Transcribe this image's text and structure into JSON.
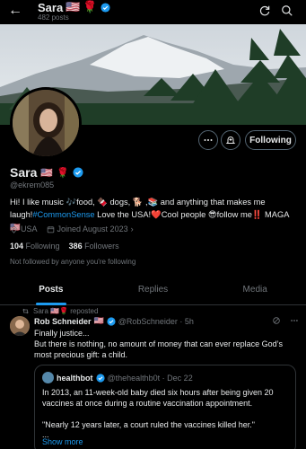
{
  "header": {
    "title": "Sara",
    "post_count": "482 posts"
  },
  "profile": {
    "display_name": "Sara",
    "handle": "@ekrem085",
    "bio": "Hi! I like music 🎶food, 🍫 dogs, 🐕 ,📚 and anything that makes me laugh!#CommonSense Love the USA!❤️Cool people 😎follow me‼️ MAGA🇺🇸",
    "location": "USA",
    "joined": "Joined August 2023",
    "following_count": "104",
    "following_label": "Following",
    "followers_count": "386",
    "followers_label": "Followers",
    "not_followed": "Not followed by anyone you're following",
    "follow_button": "Following"
  },
  "tabs": [
    {
      "label": "Posts",
      "active": true
    },
    {
      "label": "Replies",
      "active": false
    },
    {
      "label": "Media",
      "active": false
    }
  ],
  "tweet": {
    "repost_by": "Sara 🇺🇸🌹 reposted",
    "author": "Rob Schneider",
    "author_handle": "@RobSchneider · 5h",
    "text": "Finally justice...\nBut there is nothing, no amount of money that can ever replace God’s most precious gift: a child.",
    "quote": {
      "author": "healthbot",
      "handle": "@thehealthb0t · Dec 22",
      "text": "In 2013, an 11-week-old baby died six hours after being given 20 vaccines at once during a routine vaccination appointment.\n\n\"Nearly 12 years later, a court ruled the vaccines killed her.\"",
      "ellipsis": "...",
      "show_more": "Show more"
    }
  },
  "colors": {
    "accent": "#1d9bf0",
    "background": "#000000",
    "muted": "#71767b"
  }
}
